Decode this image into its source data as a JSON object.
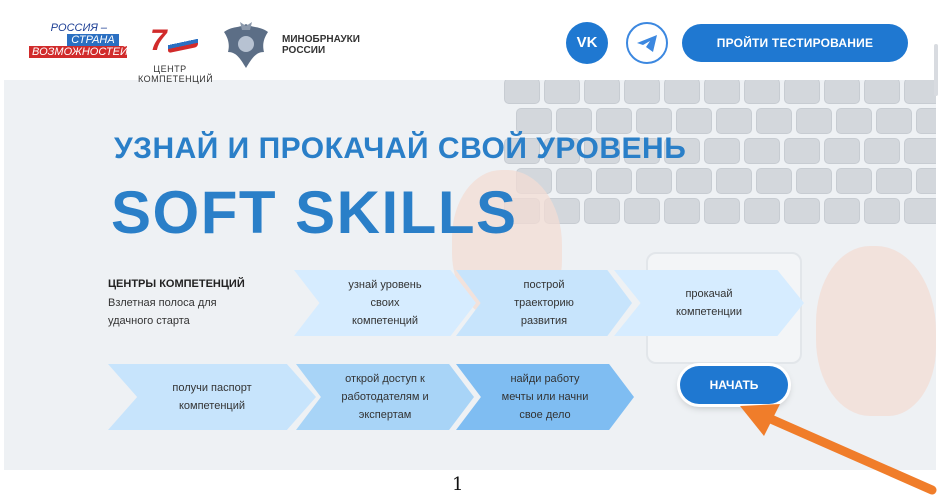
{
  "header": {
    "logo_russia": {
      "line1": "РОССИЯ –",
      "line2": "СТРАНА",
      "line3": "ВОЗМОЖНОСТЕЙ"
    },
    "logo_center": {
      "num": "7",
      "line1": "ЦЕНТР",
      "line2": "КОМПЕТЕНЦИЙ"
    },
    "logo_ministry": {
      "line1": "МИНОБРНАУКИ",
      "line2": "РОССИИ"
    },
    "social": {
      "vk_label": "VK"
    },
    "test_button": "ПРОЙТИ ТЕСТИРОВАНИЕ"
  },
  "hero": {
    "line1": "УЗНАЙ И ПРОКАЧАЙ СВОЙ УРОВЕНЬ",
    "line2": "SOFT SKILLS"
  },
  "centers": {
    "title": "ЦЕНТРЫ КОМПЕТЕНЦИЙ",
    "subtitle_line1": "Взлетная полоса для",
    "subtitle_line2": "удачного старта"
  },
  "steps": [
    {
      "lines": [
        "узнай уровень",
        "своих",
        "компетенций"
      ],
      "color": "#d6ecff"
    },
    {
      "lines": [
        "построй",
        "траекторию",
        "развития"
      ],
      "color": "#c7e4fc"
    },
    {
      "lines": [
        "прокачай",
        "компетенции"
      ],
      "color": "#d6ecff"
    },
    {
      "lines": [
        "получи паспорт",
        "компетенций"
      ],
      "color": "#c7e4fc"
    },
    {
      "lines": [
        "открой доступ к",
        "работодателям и",
        "экспертам"
      ],
      "color": "#a8d4f7"
    },
    {
      "lines": [
        "найди работу",
        "мечты или начни",
        "свое дело"
      ],
      "color": "#7fbdf2"
    }
  ],
  "start_button": "НАЧАТЬ",
  "footer": {
    "page_number": "1"
  },
  "colors": {
    "brand_blue": "#1f78d1",
    "headline_blue": "#2a7fc8",
    "arrow_orange": "#f07d2a"
  }
}
